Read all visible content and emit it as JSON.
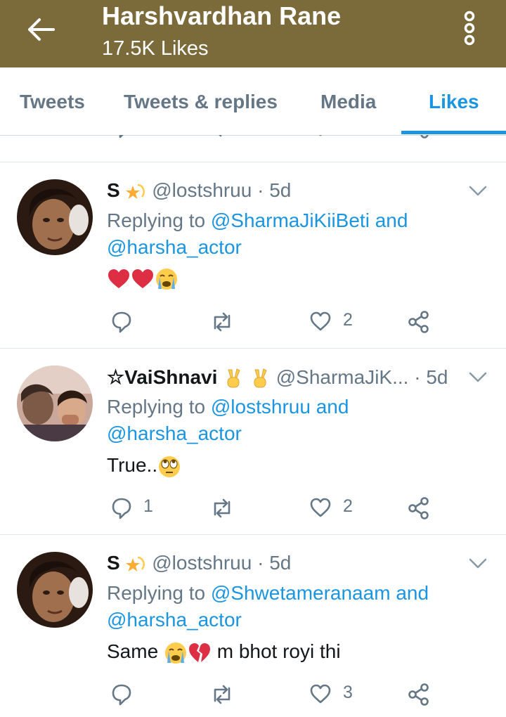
{
  "header": {
    "title": "Harshvardhan Rane",
    "subtitle": "17.5K Likes",
    "back_icon": "arrow-left-icon",
    "more_icon": "more-vertical-icon",
    "background": "#7b6a3a"
  },
  "tabs": [
    {
      "label": "Tweets"
    },
    {
      "label": "Tweets & replies"
    },
    {
      "label": "Media"
    },
    {
      "label": "Likes",
      "active": true
    }
  ],
  "accent": "#1b95e0",
  "tweets": [
    {
      "name": "S",
      "handle": "@lostshruu",
      "separator": "·",
      "time": "5d",
      "replying_prefix": "Replying to",
      "mention1": "@SharmaJiKiiBeti",
      "and": "and",
      "mention2": "@harsha_actor",
      "text": "",
      "reply_count": "",
      "like_count": "2"
    },
    {
      "name": "☆VaiShnavi",
      "handle": "@SharmaJiK...",
      "separator": "·",
      "time": "5d",
      "replying_prefix": "Replying to",
      "mention1": "@lostshruu",
      "and": "and",
      "mention2": "@harsha_actor",
      "text": "True..",
      "reply_count": "1",
      "like_count": "2"
    },
    {
      "name": "S",
      "handle": "@lostshruu",
      "separator": "·",
      "time": "5d",
      "replying_prefix": "Replying to",
      "mention1": "@Shwetameranaam",
      "and": "and",
      "mention2": "@harsha_actor",
      "text_before": "Same",
      "text_after": "m bhot royi thi",
      "reply_count": "",
      "like_count": "3"
    }
  ]
}
